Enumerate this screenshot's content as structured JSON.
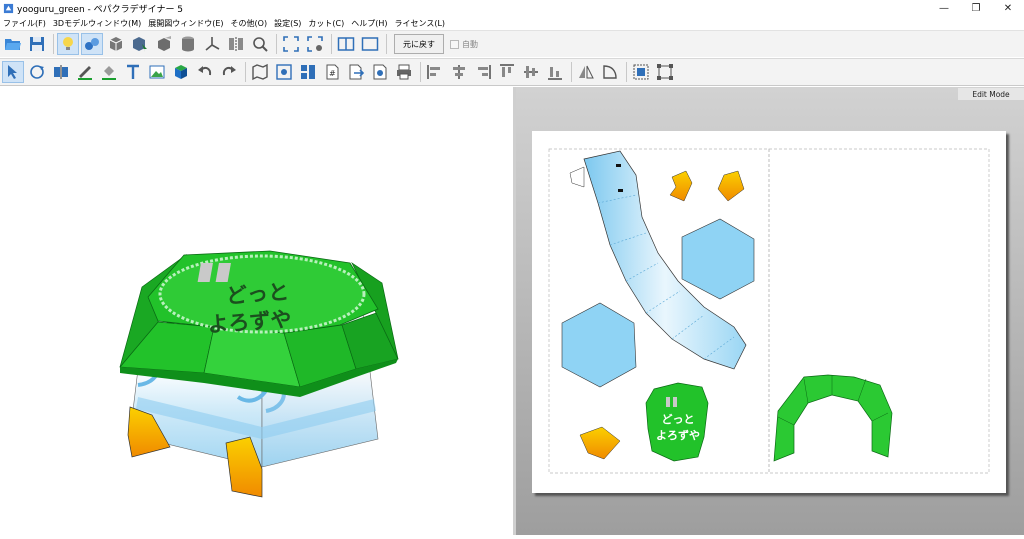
{
  "window": {
    "title": "yooguru_green - ペパクラデザイナー 5",
    "buttons": {
      "minimize": "—",
      "maximize": "❐",
      "close": "✕"
    }
  },
  "menu": [
    "ファイル(F)",
    "3Dモデルウィンドウ(M)",
    "展開図ウィンドウ(E)",
    "その他(O)",
    "設定(S)",
    "カット(C)",
    "ヘルプ(H)",
    "ライセンス(L)"
  ],
  "toolbar": {
    "revert_label": "元に戻す",
    "auto_label": "自動",
    "auto_checked": false
  },
  "pane2d": {
    "mode_label": "Edit Mode"
  },
  "model": {
    "roof_text_line1": "どっと",
    "roof_text_line2": "よろずや",
    "colors": {
      "roof_green": "#22c22a",
      "roof_dark": "#0f8f1a",
      "beak_orange": "#f5a500",
      "body_blue": "#a9dcf5",
      "face_blue": "#7cc8ef"
    }
  }
}
